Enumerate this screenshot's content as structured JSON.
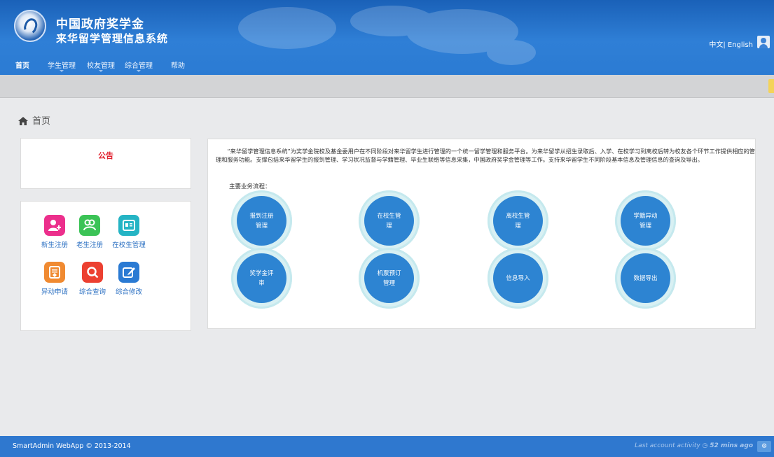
{
  "header": {
    "title_line1": "中国政府奖学金",
    "title_line2": "来华留学管理信息系统",
    "language": "中文| English",
    "nav": [
      {
        "label": "首页"
      },
      {
        "label": "学生管理"
      },
      {
        "label": "校友管理"
      },
      {
        "label": "综合管理"
      },
      {
        "label": "帮助"
      }
    ]
  },
  "breadcrumb": {
    "label": "首页"
  },
  "notice": {
    "title": "公告"
  },
  "quick_links": [
    {
      "label": "新生注册",
      "icon": "add-user-icon",
      "color": "#ec2f8c"
    },
    {
      "label": "老生注册",
      "icon": "users-icon",
      "color": "#3bc356"
    },
    {
      "label": "在校生管理",
      "icon": "id-card-icon",
      "color": "#25b4c4"
    },
    {
      "label": "异动申请",
      "icon": "form-icon",
      "color": "#f08a31"
    },
    {
      "label": "综合查询",
      "icon": "search-icon",
      "color": "#ec4031"
    },
    {
      "label": "综合修改",
      "icon": "edit-icon",
      "color": "#2a7ad3"
    }
  ],
  "main": {
    "intro": "“来华留学管理信息系统”为奖学金院校及基金委用户在不同阶段对来华留学生进行管理的一个统一留学管理和服务平台。为来华留学从招生录取后、入学、在校学习到离校后转为校友各个环节工作提供相应的管理和服务功能。支撑包括来华留学生的报到管理、学习状况监督与学籍管理、毕业生联络等信息采集，中国政府奖学金管理等工作。支持来华留学生不同阶段基本信息及管理信息的查询及导出。",
    "flow_label": "主要业务流程：",
    "flows": [
      {
        "label": "报到注册管理"
      },
      {
        "label": "在校生管理"
      },
      {
        "label": "离校生管理"
      },
      {
        "label": "学籍异动管理"
      },
      {
        "label": "奖学金评审"
      },
      {
        "label": "机票预订管理"
      },
      {
        "label": "信息导入"
      },
      {
        "label": "数据导出"
      }
    ]
  },
  "footer": {
    "copyright": "SmartAdmin WebApp © 2013-2014",
    "activity_prefix": "Last account activity",
    "activity_time": "52 mins ago"
  }
}
